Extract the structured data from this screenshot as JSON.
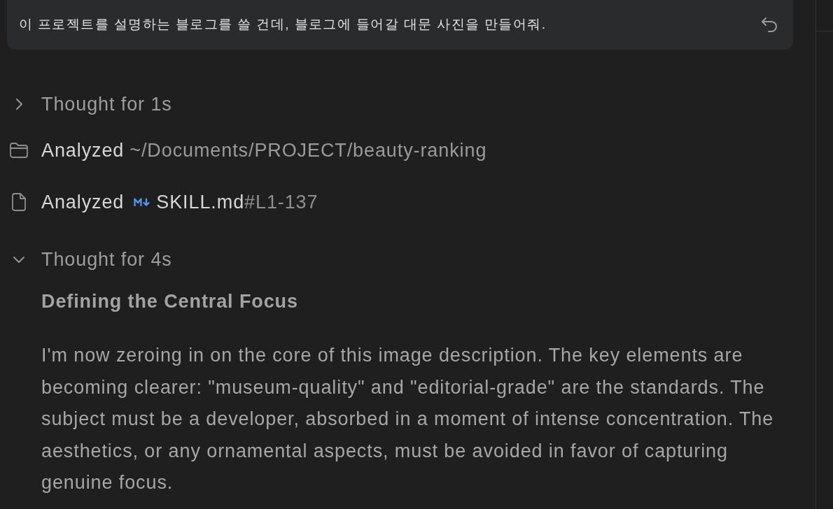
{
  "prompt": {
    "text": "이 프로젝트를 설명하는 블로그를 쓸 건데, 블로그에 들어갈 대문 사진을 만들어줘."
  },
  "steps": [
    {
      "kind": "thought",
      "label": "Thought for 1s",
      "expanded": false
    },
    {
      "kind": "folder",
      "verb": "Analyzed",
      "path": "~/Documents/PROJECT/beauty-ranking"
    },
    {
      "kind": "file",
      "verb": "Analyzed",
      "file": "SKILL.md",
      "anchor": "#L1-137"
    },
    {
      "kind": "thought",
      "label": "Thought for 4s",
      "expanded": true,
      "heading": "Defining the Central Focus",
      "body": "I'm now zeroing in on the core of this image description. The key elements are becoming clearer: \"museum-quality\" and \"editorial-grade\" are the standards. The subject must be a developer, absorbed in a moment of intense concentration. The aesthetics, or any ornamental aspects, must be avoided in favor of capturing genuine focus."
    }
  ]
}
